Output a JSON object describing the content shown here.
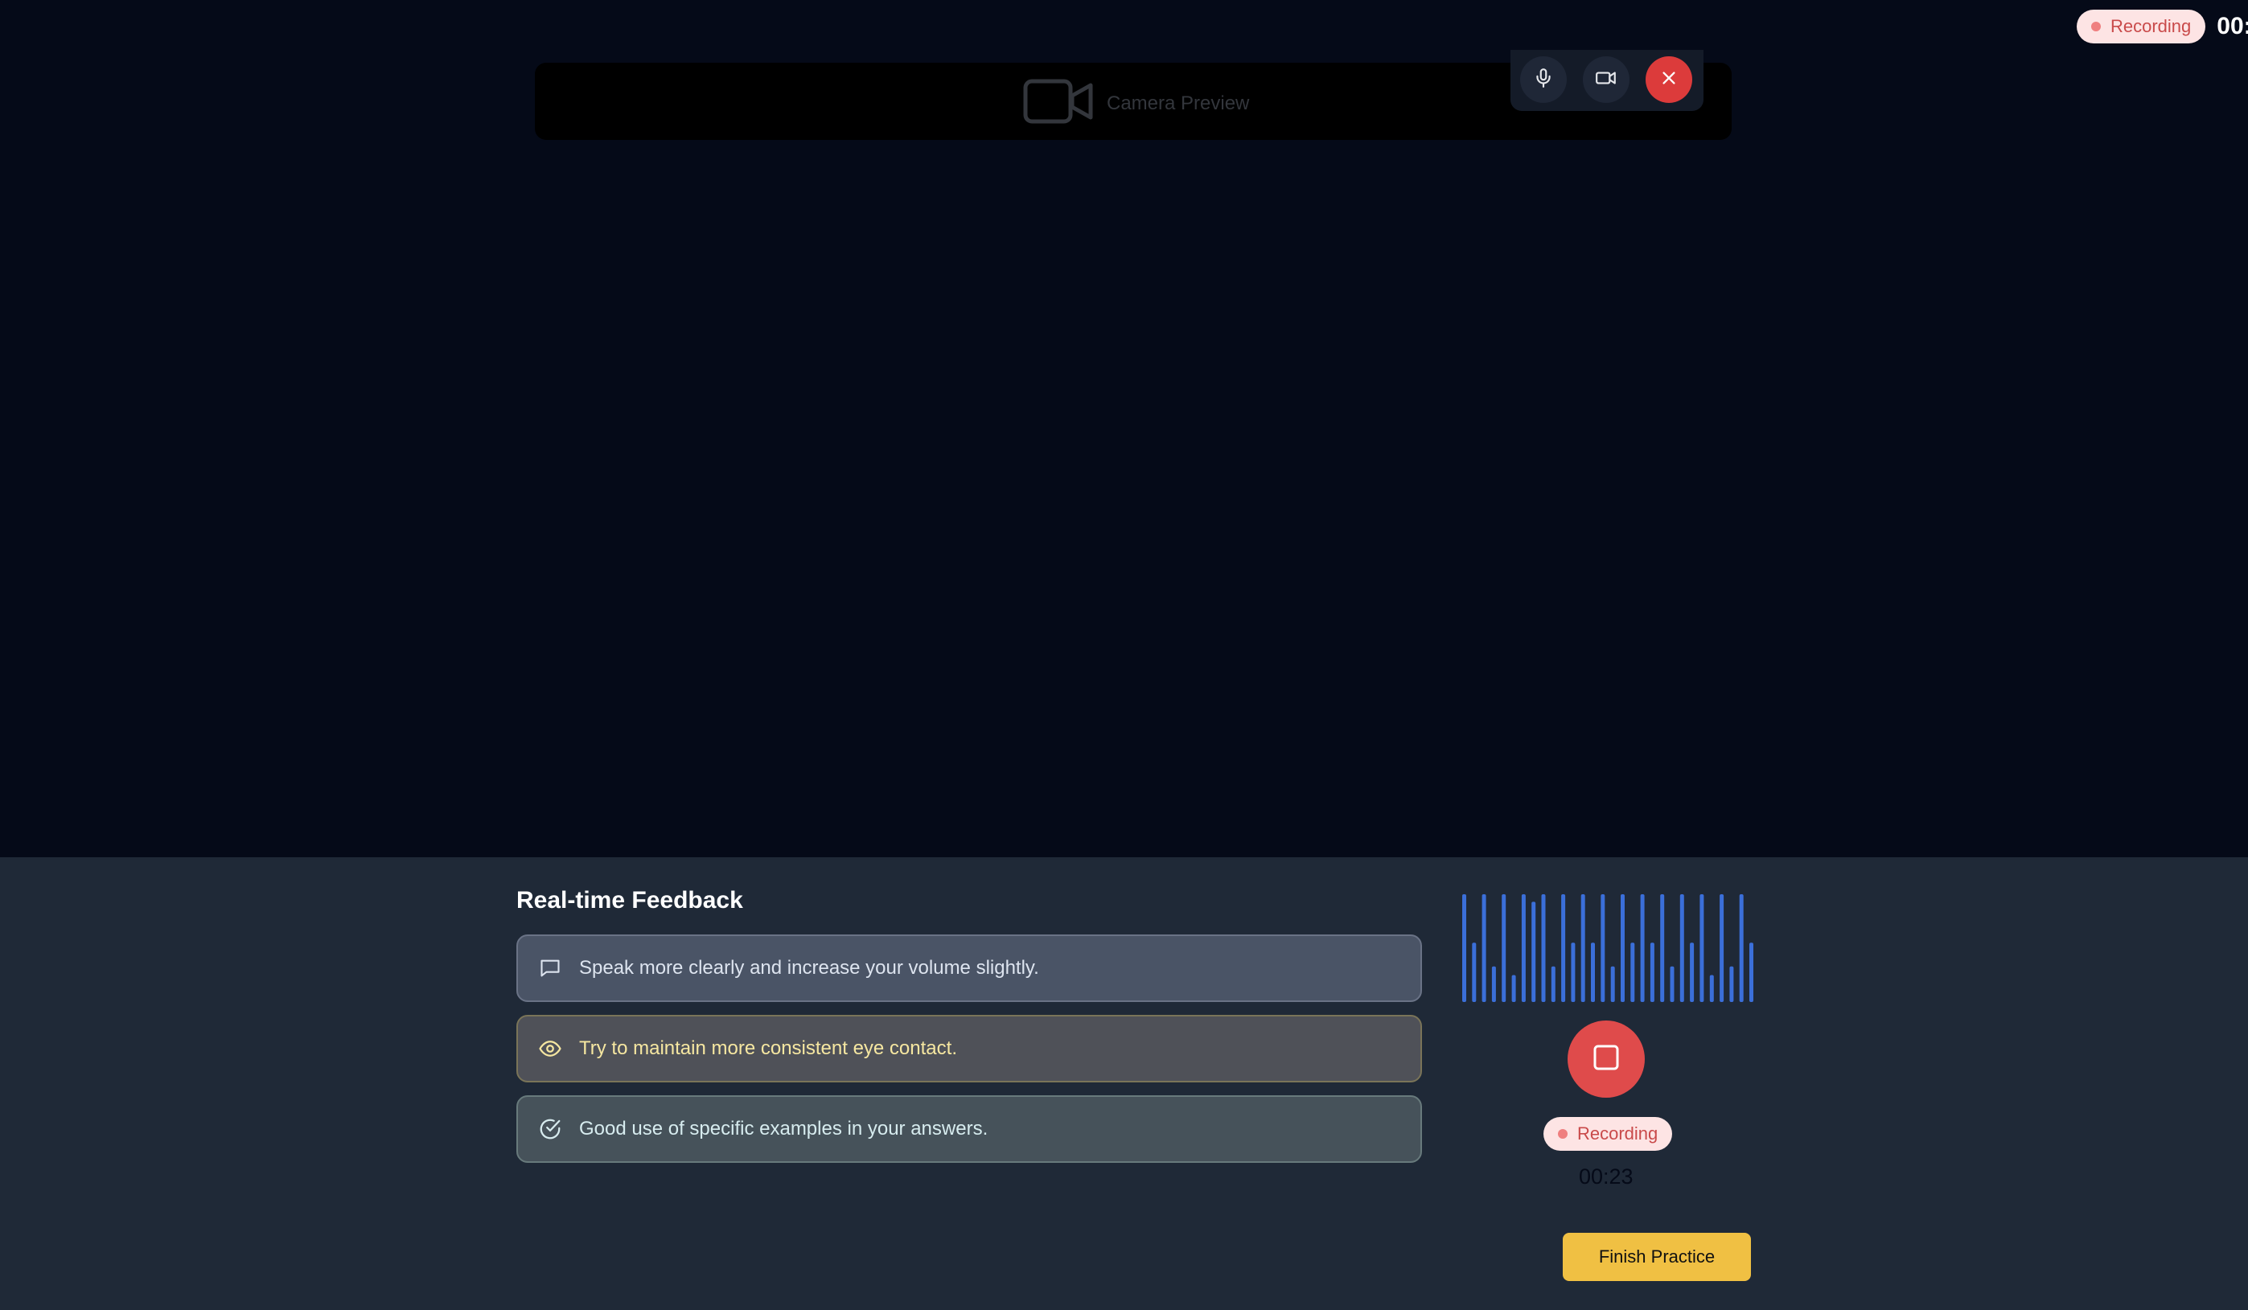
{
  "status": {
    "recording_label": "Recording",
    "elapsed_time_truncated": "00:"
  },
  "camera": {
    "preview_label": "Camera Preview",
    "controls": [
      {
        "name": "mic-toggle-button",
        "icon": "microphone-icon"
      },
      {
        "name": "camera-toggle-button",
        "icon": "video-camera-icon"
      },
      {
        "name": "end-call-button",
        "icon": "close-icon"
      }
    ]
  },
  "feedback": {
    "title": "Real-time Feedback",
    "items": [
      {
        "icon": "message-icon",
        "text": "Speak more clearly and increase your volume slightly.",
        "tone": "neutral"
      },
      {
        "icon": "eye-icon",
        "text": "Try to maintain more consistent eye contact.",
        "tone": "warning"
      },
      {
        "icon": "check-circle-icon",
        "text": "Good use of specific examples in your answers.",
        "tone": "positive"
      }
    ]
  },
  "recorder": {
    "waveform_levels": [
      1.0,
      0.55,
      1.0,
      0.33,
      1.0,
      0.25,
      1.0,
      0.93,
      1.0,
      0.33,
      1.0,
      0.55,
      1.0,
      0.55,
      1.0,
      0.33,
      1.0,
      0.55,
      1.0,
      0.55,
      1.0,
      0.33,
      1.0,
      0.55,
      1.0,
      0.25,
      1.0,
      0.33,
      1.0,
      0.55
    ],
    "waveform_color": "#3b6fd9",
    "stop_icon": "stop-icon",
    "status_label": "Recording",
    "timer": "00:23",
    "finish_label": "Finish Practice"
  },
  "colors": {
    "background": "#050a18",
    "panel": "#1f2937",
    "accent_red": "#df4b4b",
    "accent_yellow": "#f0c043"
  }
}
